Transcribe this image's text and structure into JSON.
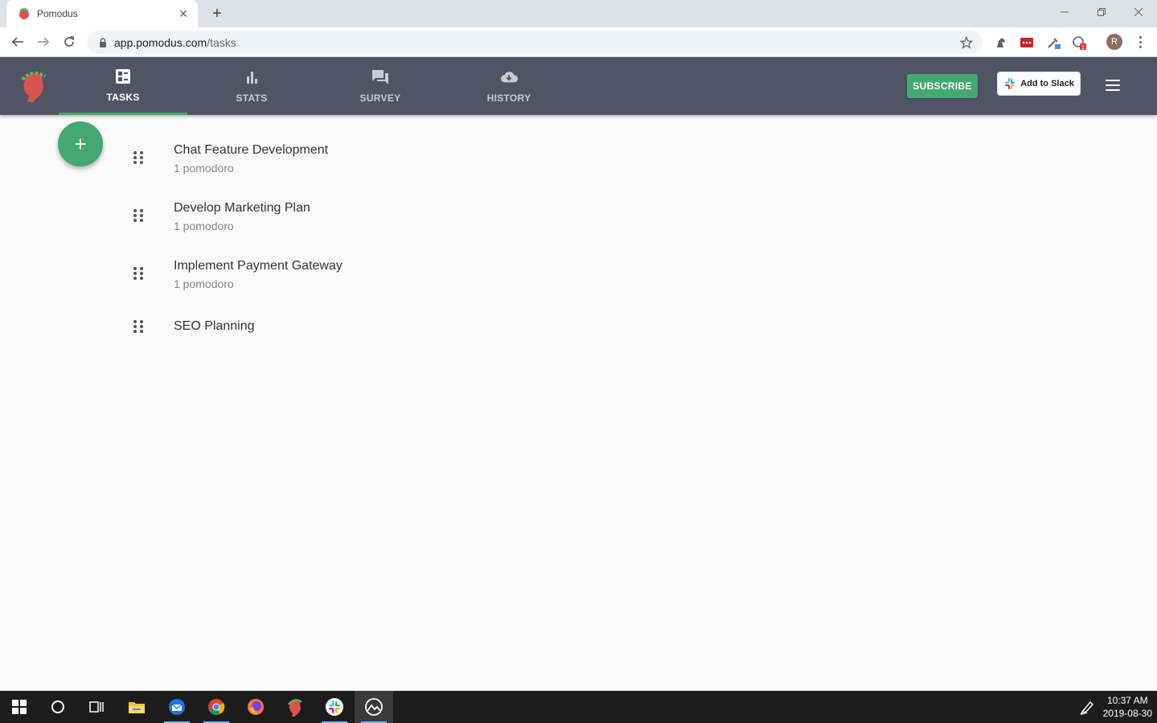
{
  "browser": {
    "tab_title": "Pomodus",
    "url_host": "app.pomodus.com",
    "url_path": "/tasks",
    "profile_initial": "R"
  },
  "nav": {
    "tabs": [
      {
        "label": "TASKS",
        "icon": "dashboard-icon",
        "active": true
      },
      {
        "label": "STATS",
        "icon": "bar-chart-icon",
        "active": false
      },
      {
        "label": "SURVEY",
        "icon": "chat-bubbles-icon",
        "active": false
      },
      {
        "label": "HISTORY",
        "icon": "cloud-download-icon",
        "active": false
      }
    ],
    "subscribe_label": "SUBSCRIBE",
    "slack_label": "Add to Slack"
  },
  "fab_label": "+",
  "tasks": [
    {
      "title": "Chat Feature Development",
      "subtitle": "1 pomodoro"
    },
    {
      "title": "Develop Marketing Plan",
      "subtitle": "1 pomodoro"
    },
    {
      "title": "Implement Payment Gateway",
      "subtitle": "1 pomodoro"
    },
    {
      "title": "SEO Planning",
      "subtitle": ""
    }
  ],
  "taskbar": {
    "time": "10:37 AM",
    "date": "2019-08-30"
  },
  "colors": {
    "appbar": "#505565",
    "accent_green": "#43a871"
  }
}
